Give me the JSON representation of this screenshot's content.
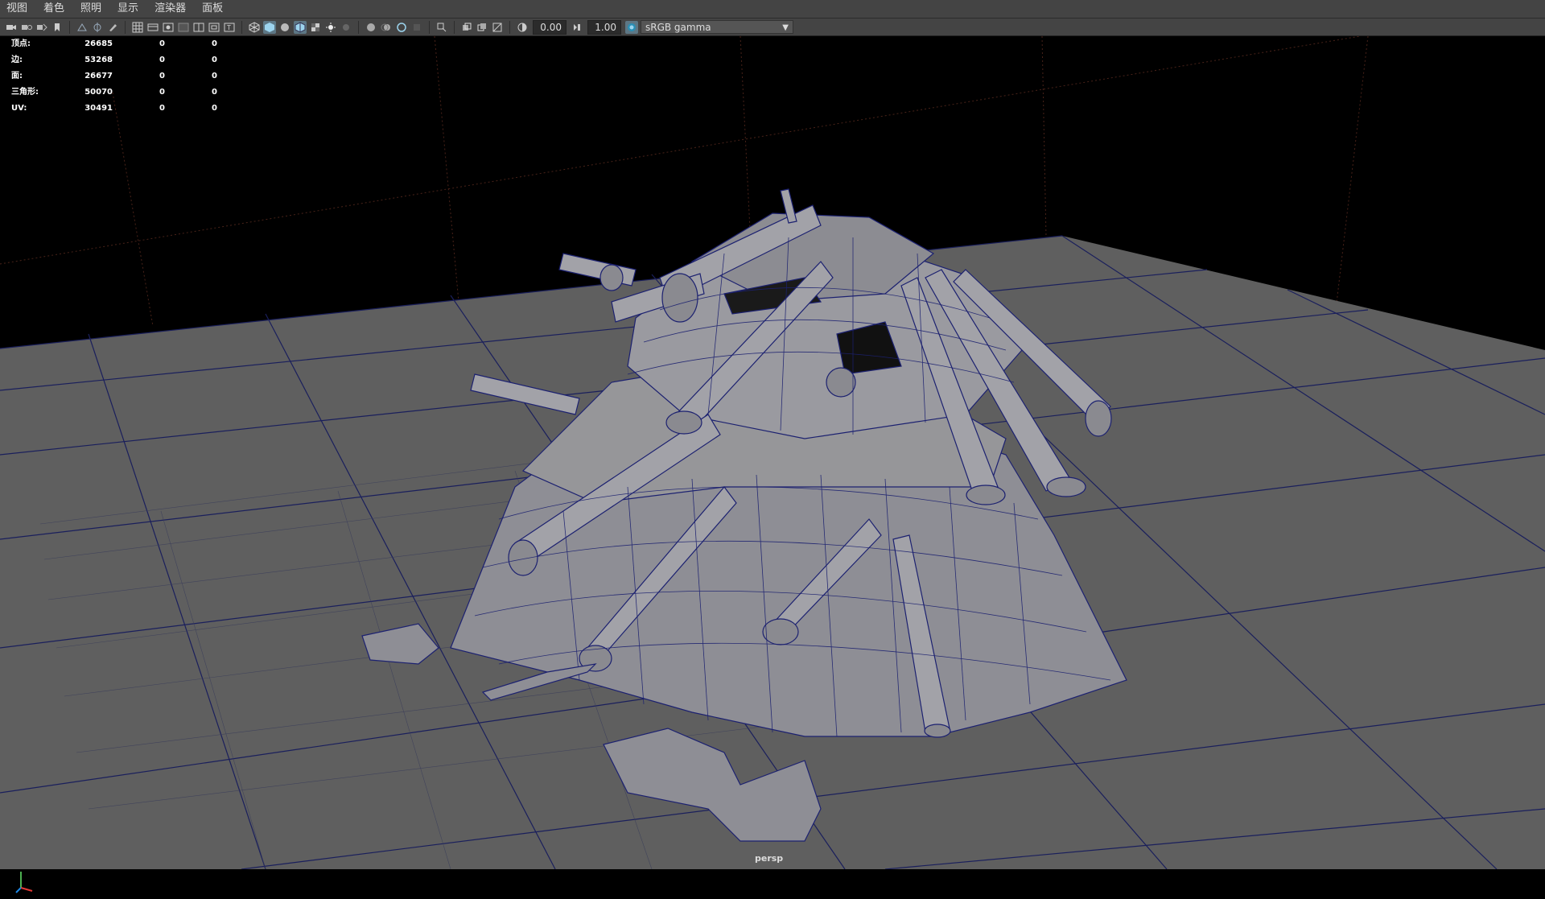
{
  "menubar": {
    "items": [
      "视图",
      "着色",
      "照明",
      "显示",
      "渲染器",
      "面板"
    ]
  },
  "toolbar": {
    "exposure_value": "0.00",
    "gamma_value": "1.00",
    "color_space": "sRGB gamma",
    "icons": [
      "camera-icon",
      "camera-attr-icon",
      "bookmark-icon",
      "image-plane-icon",
      "grid-toggle-icon",
      "film-gate-icon",
      "resolution-gate-icon",
      "safe-action-icon",
      "wireframe-icon",
      "smooth-shade-icon",
      "textured-icon",
      "lights-icon",
      "shadows-icon",
      "isolate-icon",
      "xray-icon",
      "exposure-icon",
      "gamma-icon",
      "color-mgmt-icon"
    ]
  },
  "hud": {
    "rows": [
      {
        "label": "顶点:",
        "v1": "26685",
        "v2": "0",
        "v3": "0"
      },
      {
        "label": "边:",
        "v1": "53268",
        "v2": "0",
        "v3": "0"
      },
      {
        "label": "面:",
        "v1": "26677",
        "v2": "0",
        "v3": "0"
      },
      {
        "label": "三角形:",
        "v1": "50070",
        "v2": "0",
        "v3": "0"
      },
      {
        "label": "UV:",
        "v1": "30491",
        "v2": "0",
        "v3": "0"
      }
    ]
  },
  "viewport": {
    "camera": "persp",
    "grid_color": "#1a1f5c",
    "floor_color": "#5f5f5f",
    "wire_color": "#1c2170",
    "mesh_color": "#8e8e95"
  }
}
